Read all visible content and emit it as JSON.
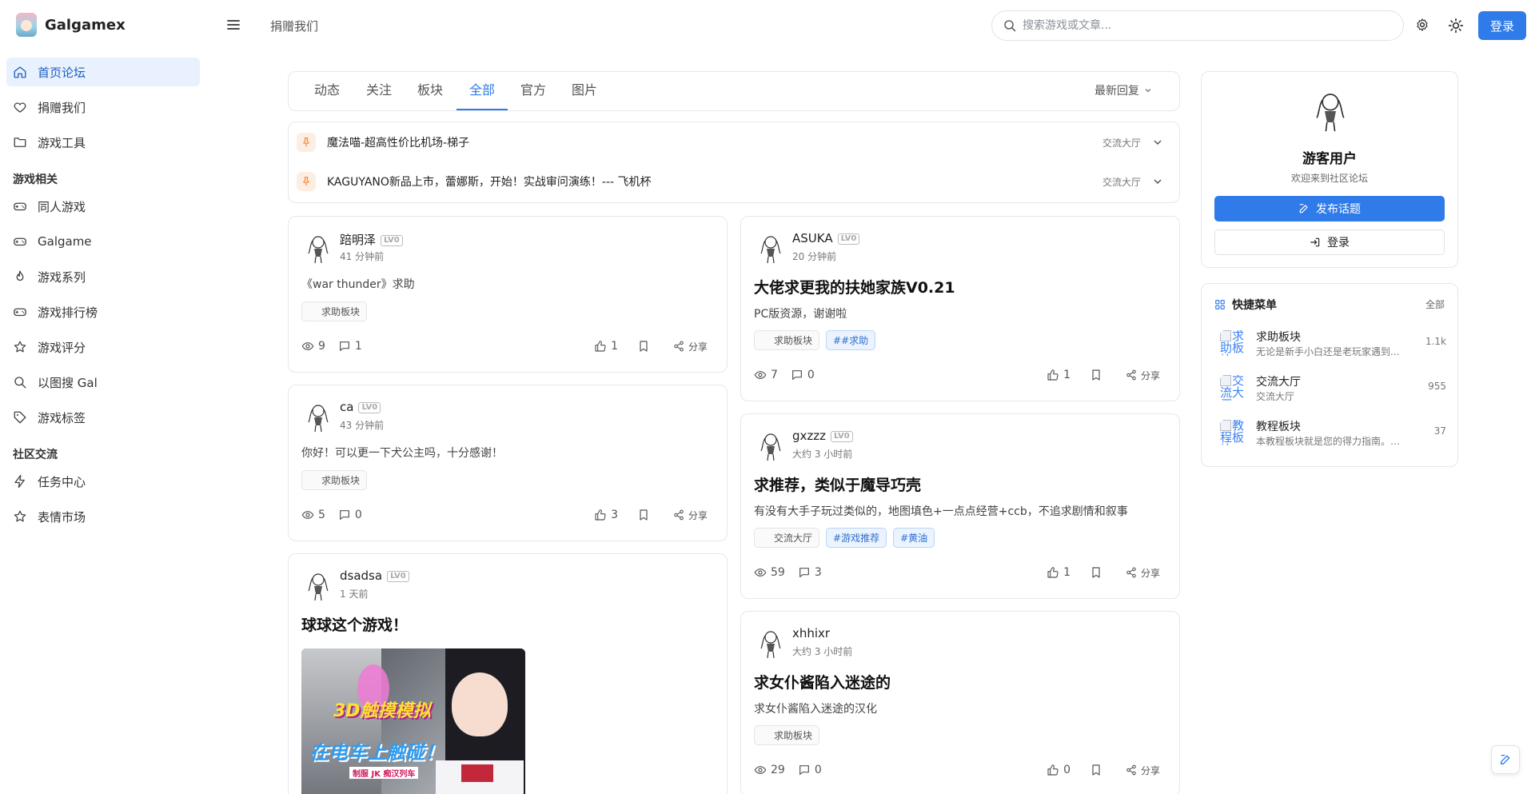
{
  "app": {
    "name": "Galgamex"
  },
  "header": {
    "donate_link": "捐赠我们",
    "search_placeholder": "搜索游戏或文章...",
    "login_label": "登录"
  },
  "sidebar": {
    "items": [
      {
        "label": "首页论坛",
        "icon": "home-icon",
        "active": true
      },
      {
        "label": "捐赠我们",
        "icon": "heart-icon"
      },
      {
        "label": "游戏工具",
        "icon": "folder-icon"
      }
    ],
    "section_game": "游戏相关",
    "game_items": [
      {
        "label": "同人游戏",
        "icon": "gamepad-icon"
      },
      {
        "label": "Galgame",
        "icon": "gamepad-icon"
      },
      {
        "label": "游戏系列",
        "icon": "flame-icon"
      },
      {
        "label": "游戏排行榜",
        "icon": "gamepad-icon"
      },
      {
        "label": "游戏评分",
        "icon": "star-icon"
      },
      {
        "label": "以图搜 Gal",
        "icon": "search-icon"
      },
      {
        "label": "游戏标签",
        "icon": "tag-icon"
      }
    ],
    "section_community": "社区交流",
    "community_items": [
      {
        "label": "任务中心",
        "icon": "zap-icon"
      },
      {
        "label": "表情市场",
        "icon": "star-icon"
      }
    ]
  },
  "tabs": {
    "items": [
      "动态",
      "关注",
      "板块",
      "全部",
      "官方",
      "图片"
    ],
    "active": "全部",
    "sort_label": "最新回复"
  },
  "pinned": [
    {
      "title": "魔法喵-超高性价比机场-梯子",
      "category": "交流大厅"
    },
    {
      "title": "KAGUYANO新品上市，蕾娜斯，开始！实战审问演练！--- 飞机杯",
      "category": "交流大厅"
    }
  ],
  "posts_left": [
    {
      "author": "踣明泽",
      "level": "LV0",
      "time": "41 分钟前",
      "title": "",
      "body": "《war thunder》求助",
      "tags": [
        "求助板块"
      ],
      "hashtags": [],
      "views": "9",
      "comments": "1",
      "likes": "1",
      "share": "分享"
    },
    {
      "author": "ca",
      "level": "LV0",
      "time": "43 分钟前",
      "title": "",
      "body": "你好！可以更一下犬公主吗，十分感谢！",
      "tags": [
        "求助板块"
      ],
      "hashtags": [],
      "views": "5",
      "comments": "0",
      "likes": "3",
      "share": "分享"
    },
    {
      "author": "dsadsa",
      "level": "LV0",
      "time": "1 天前",
      "title": "球球这个游戏！",
      "body": "",
      "tags": [],
      "hashtags": [],
      "image_text": [
        "3D触摸模拟",
        "在电车上触碰！",
        "制服 JK 痴汉列车"
      ]
    }
  ],
  "posts_right": [
    {
      "author": "ASUKA",
      "level": "LV0",
      "time": "20 分钟前",
      "title": "大佬求更我的扶她家族V0.21",
      "body": "PC版资源，谢谢啦",
      "tags": [
        "求助板块"
      ],
      "hashtags": [
        "##求助"
      ],
      "views": "7",
      "comments": "0",
      "likes": "1",
      "share": "分享"
    },
    {
      "author": "gxzzz",
      "level": "LV0",
      "time": "大约 3 小时前",
      "title": "求推荐，类似于魔导巧壳",
      "body": "有没有大手子玩过类似的，地图填色+一点点经营+ccb，不追求剧情和叙事",
      "tags": [
        "交流大厅"
      ],
      "hashtags": [
        "#游戏推荐",
        "#黄油"
      ],
      "views": "59",
      "comments": "3",
      "likes": "1",
      "share": "分享"
    },
    {
      "author": "xhhixr",
      "level": "",
      "time": "大约 3 小时前",
      "title": "求女仆酱陷入迷途的",
      "body": "求女仆酱陷入迷途的汉化",
      "tags": [
        "求助板块"
      ],
      "hashtags": [],
      "views": "29",
      "comments": "0",
      "likes": "0",
      "share": "分享"
    }
  ],
  "user_card": {
    "name": "游客用户",
    "subtitle": "欢迎来到社区论坛",
    "post_button": "发布话题",
    "login_button": "登录"
  },
  "quick_menu": {
    "title": "快捷菜单",
    "all_label": "全部",
    "items": [
      {
        "name": "求助板块",
        "desc": "无论是新手小白还是老玩家遇到...",
        "count": "1.1k",
        "img_alt": "求助板块"
      },
      {
        "name": "交流大厅",
        "desc": "交流大厅",
        "count": "955",
        "img_alt": "交流大厅"
      },
      {
        "name": "教程板块",
        "desc": "本教程板块就是您的得力指南。无...",
        "count": "37",
        "img_alt": "教程板块"
      }
    ]
  },
  "colors": {
    "accent": "#2f7bea",
    "active_bg": "#e8f1fd",
    "pin_badge": "#fdeee3"
  }
}
